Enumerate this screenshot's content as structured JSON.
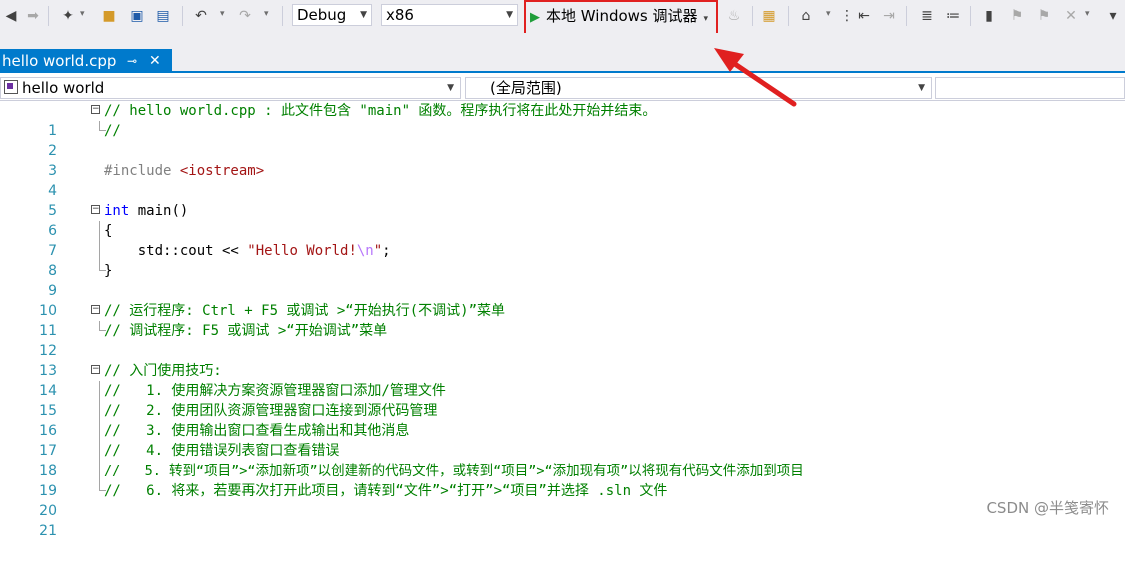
{
  "toolbar": {
    "config": "Debug",
    "platform": "x86",
    "run_label": "本地 Windows 调试器"
  },
  "tab": {
    "label": "hello world.cpp",
    "pin": "⊸",
    "close": "✕"
  },
  "nav": {
    "project": "hello world",
    "scope": "(全局范围)",
    "member": ""
  },
  "lines": [
    {
      "n": "1",
      "t": "// hello world.cpp : 此文件包含 \"main\" 函数。程序执行将在此处开始并结束。"
    },
    {
      "n": "2",
      "t": "//"
    },
    {
      "n": "3",
      "t": ""
    },
    {
      "n": "4",
      "pp": "#include ",
      "inc": "<iostream>"
    },
    {
      "n": "5",
      "t": ""
    },
    {
      "n": "6",
      "kw": "int",
      "rest": " main()"
    },
    {
      "n": "7",
      "t": "{"
    },
    {
      "n": "8",
      "a": "    std::cout << ",
      "s": "\"Hello World!",
      "e": "\\n",
      "s2": "\"",
      "b": ";"
    },
    {
      "n": "9",
      "t": "}"
    },
    {
      "n": "10",
      "t": ""
    },
    {
      "n": "11",
      "t": "// 运行程序: Ctrl + F5 或调试 >“开始执行(不调试)”菜单"
    },
    {
      "n": "12",
      "t": "// 调试程序: F5 或调试 >“开始调试”菜单"
    },
    {
      "n": "13",
      "t": ""
    },
    {
      "n": "14",
      "t": "// 入门使用技巧:"
    },
    {
      "n": "15",
      "t": "//   1. 使用解决方案资源管理器窗口添加/管理文件"
    },
    {
      "n": "16",
      "t": "//   2. 使用团队资源管理器窗口连接到源代码管理"
    },
    {
      "n": "17",
      "t": "//   3. 使用输出窗口查看生成输出和其他消息"
    },
    {
      "n": "18",
      "t": "//   4. 使用错误列表窗口查看错误"
    },
    {
      "n": "19",
      "t": "//   5. 转到“项目”>“添加新项”以创建新的代码文件，或转到“项目”>“添加现有项”以将现有代码文件添加到项目"
    },
    {
      "n": "20",
      "t": "//   6. 将来，若要再次打开此项目，请转到“文件”>“打开”>“项目”并选择 .sln 文件"
    },
    {
      "n": "21",
      "t": ""
    }
  ],
  "watermark": "CSDN @半笺寄怀",
  "colors": {
    "accent": "#007acc",
    "highlight_box": "#e02020",
    "comment": "#008000",
    "keyword": "#0000ff",
    "line_number": "#2b91af"
  }
}
